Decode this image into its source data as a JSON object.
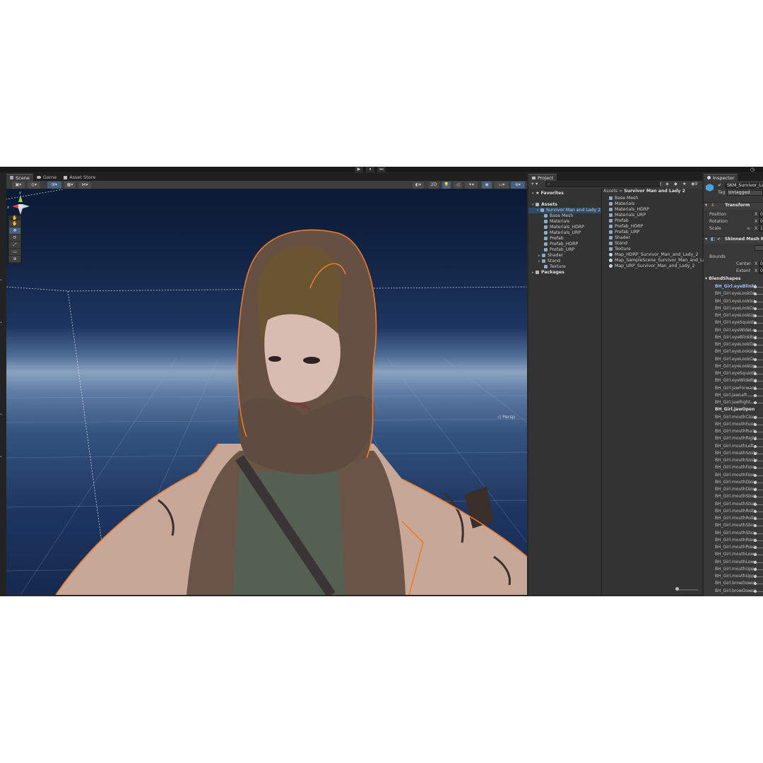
{
  "play_controls": [
    "▶",
    "⏸",
    "⏭"
  ],
  "scene_panel": {
    "tabs": [
      {
        "label": "Scene",
        "icon": "scene-icon",
        "active": true
      },
      {
        "label": "Game",
        "icon": "game-icon",
        "active": false
      },
      {
        "label": "Asset Store",
        "icon": "store-icon",
        "active": false
      }
    ],
    "toolbar": {
      "mode_2d": "2D"
    },
    "tools": [
      "✋",
      "✥",
      "⟳",
      "⤢",
      "▭",
      "⊕"
    ],
    "camera": "Persp",
    "gizmo_axes": {
      "x": "x",
      "y": "y",
      "z": "z"
    }
  },
  "project_panel": {
    "tab": "Project",
    "favorites": "Favorites",
    "tree": {
      "root": "Assets",
      "package": "Survivor Man and Lady 2",
      "children": [
        "Base Mesh",
        "Materials",
        "Materials_HDRP",
        "Materials_URP",
        "Prefab",
        "Prefab_HDRP",
        "Prefab_URP",
        "Shader",
        "Stand",
        "Texture"
      ],
      "packages": "Packages"
    },
    "breadcrumb": {
      "root": "Assets",
      "sep": ">",
      "current": "Survivor Man and Lady 2"
    },
    "folders": [
      "Base Mesh",
      "Materials",
      "Materials_HDRP",
      "Materials_URP",
      "Prefab",
      "Prefab_HDRP",
      "Prefab_URP",
      "Shader",
      "Stand",
      "Texture"
    ],
    "scenes": [
      "Map_HDRP_Survivor_Man_and_Lady_2",
      "Map_SampleScene_Survivor_Man_and_Lad",
      "Map_URP_Survivor_Man_and_Lady_2"
    ],
    "count_badge": "9"
  },
  "inspector": {
    "tab": "Inspector",
    "object_name": "SKM_Survivor_La",
    "tag_label": "Tag",
    "tag_value": "Untagged",
    "transform": {
      "title": "Transform",
      "rows": [
        {
          "label": "Position",
          "axis": "X",
          "value": "0"
        },
        {
          "label": "Rotation",
          "axis": "X",
          "value": "0"
        },
        {
          "label": "Scale",
          "axis": "X",
          "value": "1"
        }
      ]
    },
    "skinned_mesh": {
      "title": "Skinned Mesh Ren",
      "bounds_label": "Bounds",
      "center_label": "Center",
      "extent_label": "Extent",
      "center_axis": "X",
      "extent_axis": "X",
      "center_value": "0",
      "extent_value": "0"
    },
    "blendshapes": {
      "title": "BlendShapes",
      "items": [
        "BH_Girl.eyeBlinkLe",
        "BH_Girl.eyeLookDo",
        "BH_Girl.eyeLookInL",
        "BH_Girl.eyeLookOu",
        "BH_Girl.eyeLookUp",
        "BH_Girl.eyeSquintL",
        "BH_Girl.eyeWideLe",
        "BH_Girl.eyeBlinkRig",
        "BH_Girl.eyeLookDo",
        "BH_Girl.eyeLookInF",
        "BH_Girl.eyeLookOu",
        "BH_Girl.eyeLookUp",
        "BH_Girl.eyeSquintR",
        "BH_Girl.eyeWideRig",
        "BH_Girl.jawForward",
        "BH_Girl.jawLeft",
        "BH_Girl.jawRight",
        "BH_Girl.jawOpen",
        "BH_Girl.mouthClose",
        "BH_Girl.mouthFunn",
        "BH_Girl.mouthPuck",
        "BH_Girl.mouthRight",
        "BH_Girl.mouthLeft",
        "BH_Girl.mouthSmile",
        "BH_Girl.mouthSmile",
        "BH_Girl.mouthFrow",
        "BH_Girl.mouthFrow",
        "BH_Girl.mouthDimp",
        "BH_Girl.mouthDimp",
        "BH_Girl.mouthStret",
        "BH_Girl.mouthStret",
        "BH_Girl.mouthRollL",
        "BH_Girl.mouthRollU",
        "BH_Girl.mouthShru",
        "BH_Girl.mouthShru",
        "BH_Girl.mouthPress",
        "BH_Girl.mouthPress",
        "BH_Girl.mouthLowe",
        "BH_Girl.mouthLowe",
        "BH_Girl.mouthUppe",
        "BH_Girl.mouthUppe",
        "BH_Girl.browDownl",
        "BH_Girl.browDownI"
      ]
    }
  },
  "colors": {
    "editor_bg": "#282828",
    "panel_bg": "#333333",
    "selection": "#2d4a6b",
    "accent_blue": "#46607f",
    "outline_orange": "#f07a2a"
  }
}
